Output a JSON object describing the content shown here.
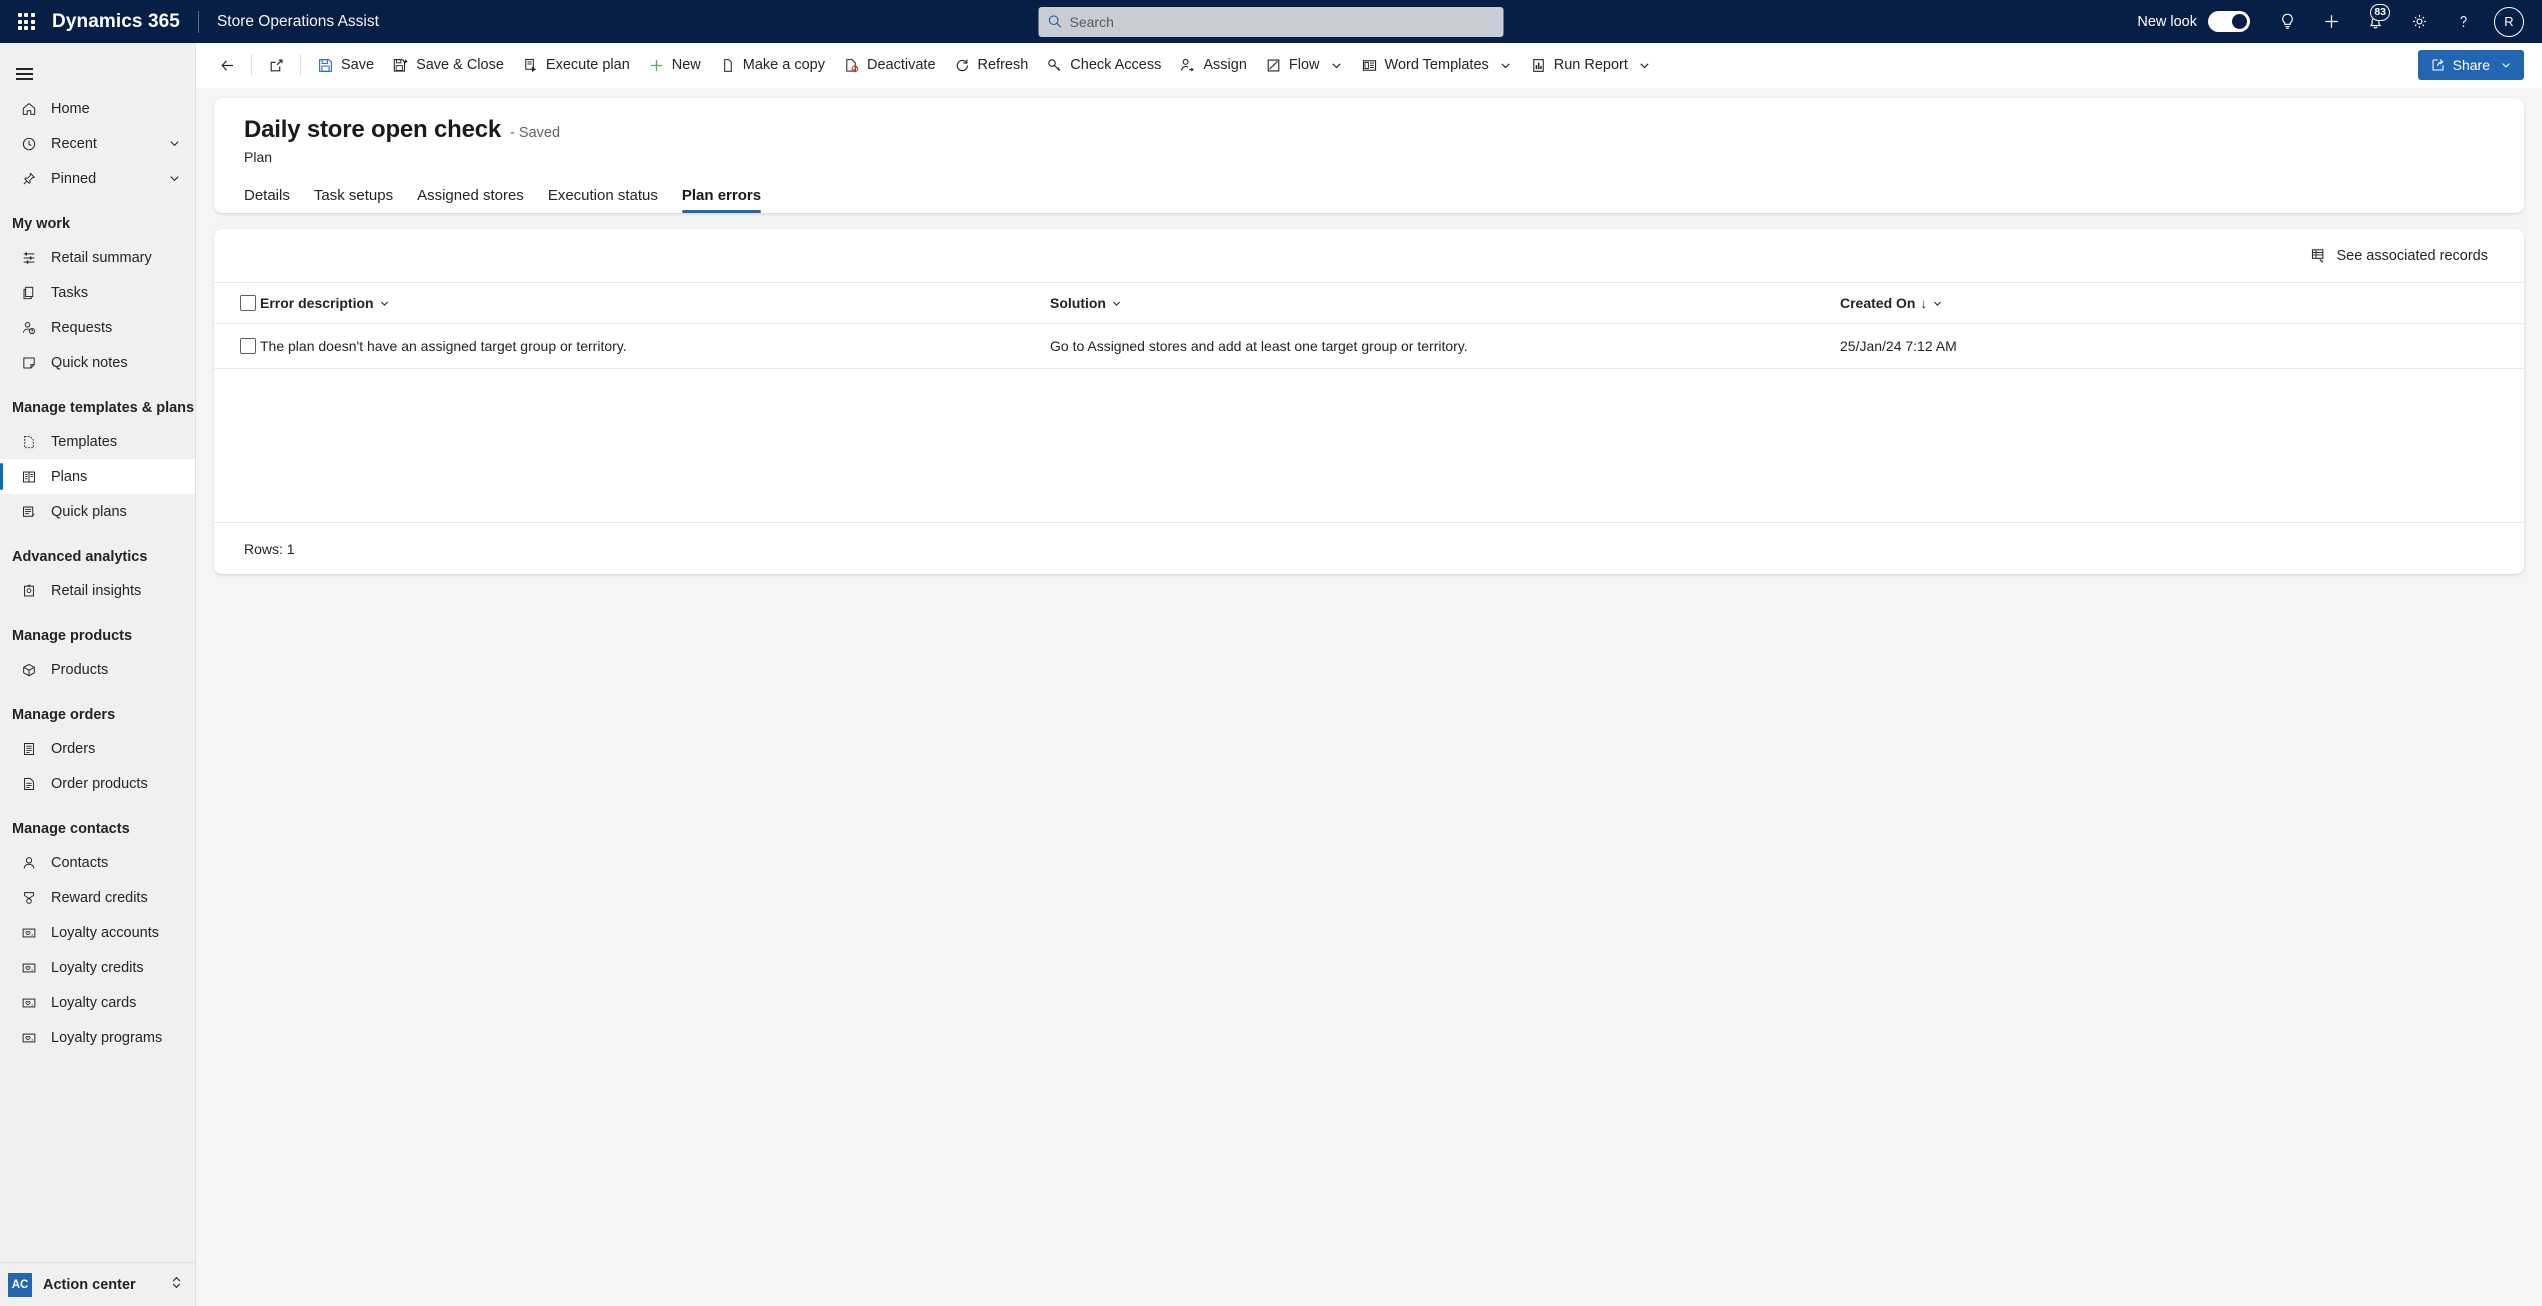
{
  "appbar": {
    "waffle_label": "app-launcher",
    "brand": "Dynamics 365",
    "app_name": "Store Operations Assist",
    "search": {
      "placeholder": "Search",
      "value": ""
    },
    "new_look_label": "New look",
    "new_look_on": true,
    "notification_count": "83",
    "avatar_initials": "R",
    "icons": [
      "search-icon",
      "lightbulb-icon",
      "plus-icon",
      "bell-icon",
      "gear-icon",
      "question-icon",
      "avatar"
    ]
  },
  "sidebar": {
    "top_items": [
      {
        "label": "Home",
        "icon": "home-icon",
        "expandable": false,
        "selected": false
      },
      {
        "label": "Recent",
        "icon": "clock-icon",
        "expandable": true,
        "selected": false
      },
      {
        "label": "Pinned",
        "icon": "pin-icon",
        "expandable": true,
        "selected": false
      }
    ],
    "groups": [
      {
        "title": "My work",
        "items": [
          {
            "label": "Retail summary",
            "icon": "dashboard-icon",
            "selected": false
          },
          {
            "label": "Tasks",
            "icon": "tasks-icon",
            "selected": false
          },
          {
            "label": "Requests",
            "icon": "requests-icon",
            "selected": false
          },
          {
            "label": "Quick notes",
            "icon": "note-icon",
            "selected": false
          }
        ]
      },
      {
        "title": "Manage templates & plans",
        "items": [
          {
            "label": "Templates",
            "icon": "template-icon",
            "selected": false
          },
          {
            "label": "Plans",
            "icon": "plans-icon",
            "selected": true
          },
          {
            "label": "Quick plans",
            "icon": "quick-plans-icon",
            "selected": false
          }
        ]
      },
      {
        "title": "Advanced analytics",
        "items": [
          {
            "label": "Retail insights",
            "icon": "insights-icon",
            "selected": false
          }
        ]
      },
      {
        "title": "Manage products",
        "items": [
          {
            "label": "Products",
            "icon": "product-box-icon",
            "selected": false
          }
        ]
      },
      {
        "title": "Manage orders",
        "items": [
          {
            "label": "Orders",
            "icon": "order-icon",
            "selected": false
          },
          {
            "label": "Order products",
            "icon": "order-products-icon",
            "selected": false
          }
        ]
      },
      {
        "title": "Manage contacts",
        "items": [
          {
            "label": "Contacts",
            "icon": "person-icon",
            "selected": false
          },
          {
            "label": "Reward credits",
            "icon": "medal-icon",
            "selected": false
          },
          {
            "label": "Loyalty accounts",
            "icon": "card-icon",
            "selected": false
          },
          {
            "label": "Loyalty credits",
            "icon": "card-icon",
            "selected": false
          },
          {
            "label": "Loyalty cards",
            "icon": "card-icon",
            "selected": false
          },
          {
            "label": "Loyalty programs",
            "icon": "card-icon",
            "selected": false
          }
        ]
      }
    ],
    "footer": {
      "badge": "AC",
      "label": "Action center"
    }
  },
  "commandbar": {
    "back_label": "Back",
    "popout_label": "Open in new window",
    "buttons": [
      {
        "label": "Save",
        "icon": "save-icon",
        "chevron": false
      },
      {
        "label": "Save & Close",
        "icon": "save-close-icon",
        "chevron": false
      },
      {
        "label": "Execute plan",
        "icon": "execute-icon",
        "chevron": false
      },
      {
        "label": "New",
        "icon": "plus-icon",
        "chevron": false
      },
      {
        "label": "Make a copy",
        "icon": "copy-icon",
        "chevron": false
      },
      {
        "label": "Deactivate",
        "icon": "deactivate-icon",
        "chevron": false
      },
      {
        "label": "Refresh",
        "icon": "refresh-icon",
        "chevron": false
      },
      {
        "label": "Check Access",
        "icon": "key-icon",
        "chevron": false
      },
      {
        "label": "Assign",
        "icon": "assign-icon",
        "chevron": false
      },
      {
        "label": "Flow",
        "icon": "flow-icon",
        "chevron": true
      },
      {
        "label": "Word Templates",
        "icon": "word-template-icon",
        "chevron": true
      },
      {
        "label": "Run Report",
        "icon": "report-icon",
        "chevron": true
      }
    ],
    "share": {
      "label": "Share",
      "icon": "share-icon",
      "chevron": true,
      "color": "#2266b3"
    }
  },
  "record": {
    "title": "Daily store open check",
    "status": "- Saved",
    "entity": "Plan"
  },
  "tabs": [
    {
      "label": "Details",
      "active": false
    },
    {
      "label": "Task setups",
      "active": false
    },
    {
      "label": "Assigned stores",
      "active": false
    },
    {
      "label": "Execution status",
      "active": false
    },
    {
      "label": "Plan errors",
      "active": true
    }
  ],
  "grid": {
    "associated_records_label": "See associated records",
    "associated_records_icon": "associated-records-icon",
    "columns": [
      {
        "label": "Error description",
        "sort": "",
        "chevron": true
      },
      {
        "label": "Solution",
        "sort": "",
        "chevron": true
      },
      {
        "label": "Created On",
        "sort": "↓",
        "chevron": true
      }
    ],
    "rows": [
      {
        "error_description": "The plan doesn't have an assigned target group or territory.",
        "solution": "Go to Assigned stores and add at least one target group or territory.",
        "created_on": "25/Jan/24 7:12 AM"
      }
    ],
    "footer_label": "Rows: 1"
  },
  "colors": {
    "header_bg": "#071f47",
    "accent": "#2266b3",
    "sidebar_bg": "#f0f0f0",
    "page_bg": "#f5f5f5"
  }
}
